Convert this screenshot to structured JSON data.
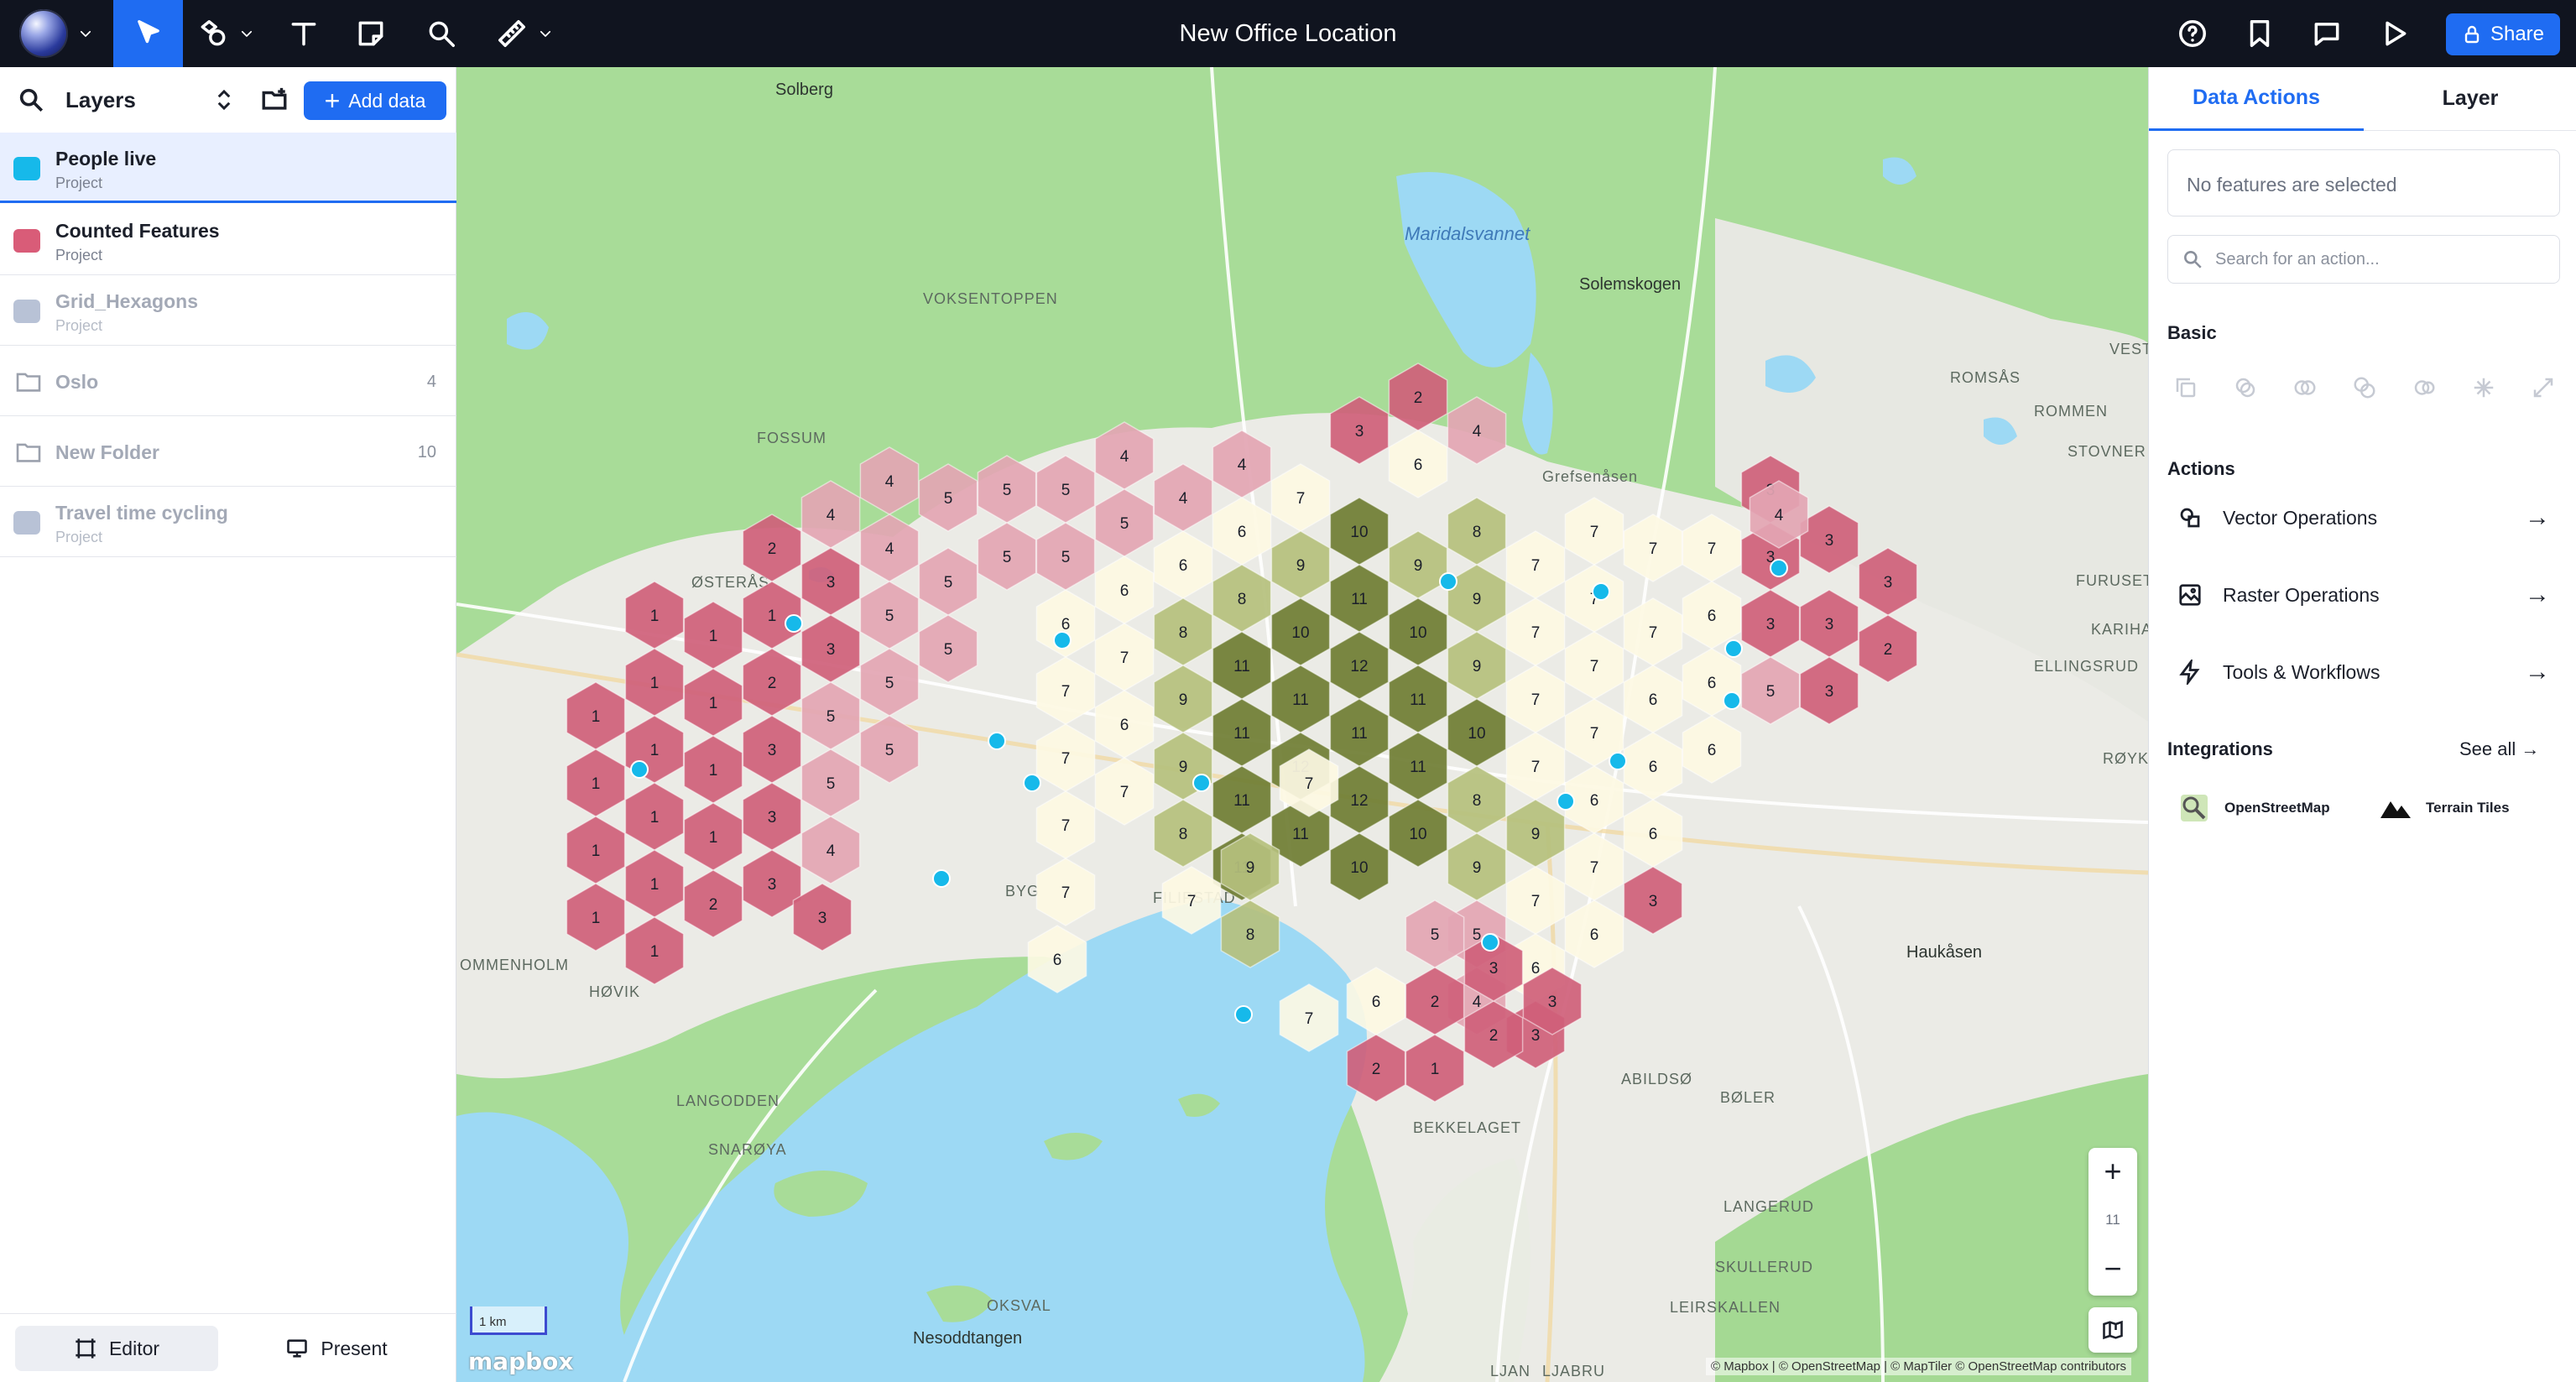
{
  "app": {
    "title": "New Office Location",
    "share_label": "Share"
  },
  "layers_panel": {
    "title": "Layers",
    "add_data_label": "Add data",
    "layers": [
      {
        "name": "People live",
        "subtitle": "Project",
        "color": "#16b9ea"
      },
      {
        "name": "Counted Features",
        "subtitle": "Project",
        "color": "#d95c78"
      },
      {
        "name": "Grid_Hexagons",
        "subtitle": "Project",
        "color": "#b8c2d6"
      },
      {
        "name": "Travel time cycling",
        "subtitle": "Project",
        "color": "#b8c2d6"
      }
    ],
    "folders": [
      {
        "name": "Oslo",
        "count": "4"
      },
      {
        "name": "New Folder",
        "count": "10"
      }
    ],
    "modes": {
      "editor": "Editor",
      "present": "Present"
    }
  },
  "map": {
    "zoom_in": "+",
    "zoom_level": "11",
    "zoom_out": "−",
    "scale_label": "1 km",
    "logo": "mapbox",
    "attribution": "© Mapbox  |  © OpenStreetMap  |  © MapTiler  © OpenStreetMap contributors",
    "place_labels": [
      "Solberg",
      "Maridalsvannet",
      "Solemskogen",
      "VOKSENTOPPEN",
      "FOSSUM",
      "Grefsenåsen",
      "ROMSÅS",
      "ROMMEN",
      "STOVNER",
      "VESTL",
      "ØSTERÅS",
      "FURUSET",
      "KARIHA",
      "ELLINGSRUD",
      "RØYK",
      "BYG",
      "FILIPSTAD",
      "OMMENHOLM",
      "HØVIK",
      "Haukåsen",
      "ABILDSØ",
      "BØLER",
      "BEKKELAGET",
      "LANGODDEN",
      "SNARØYA",
      "LANGERUD",
      "SKULLERUD",
      "LEIRSKALLEN",
      "OKSVAL",
      "Nesoddtangen",
      "LJAN",
      "LJABRU"
    ],
    "hexagon_counts": [
      "1",
      "2",
      "3",
      "4",
      "5",
      "6",
      "7",
      "8",
      "9",
      "10",
      "11",
      "12"
    ],
    "hex_colors": {
      "1": "#cf5f7a",
      "2": "#cf5f7a",
      "3": "#cf5f7a",
      "4": "#e3a5b3",
      "5": "#e3a5b3",
      "6": "#fdf9e3",
      "7": "#fdf9e3",
      "8": "#b5c07d",
      "9": "#b5c07d",
      "10": "#6f7d33",
      "11": "#6f7d33",
      "12": "#6f7d33"
    },
    "point_color": "#16b9ea"
  },
  "right_panel": {
    "tabs": [
      "Data Actions",
      "Layer"
    ],
    "selection_text": "No features are selected",
    "search_placeholder": "Search for an action...",
    "basic_title": "Basic",
    "actions_title": "Actions",
    "actions": [
      "Vector Operations",
      "Raster Operations",
      "Tools & Workflows"
    ],
    "integrations_title": "Integrations",
    "see_all": "See all →",
    "integrations": [
      "OpenStreetMap",
      "Terrain Tiles"
    ]
  }
}
